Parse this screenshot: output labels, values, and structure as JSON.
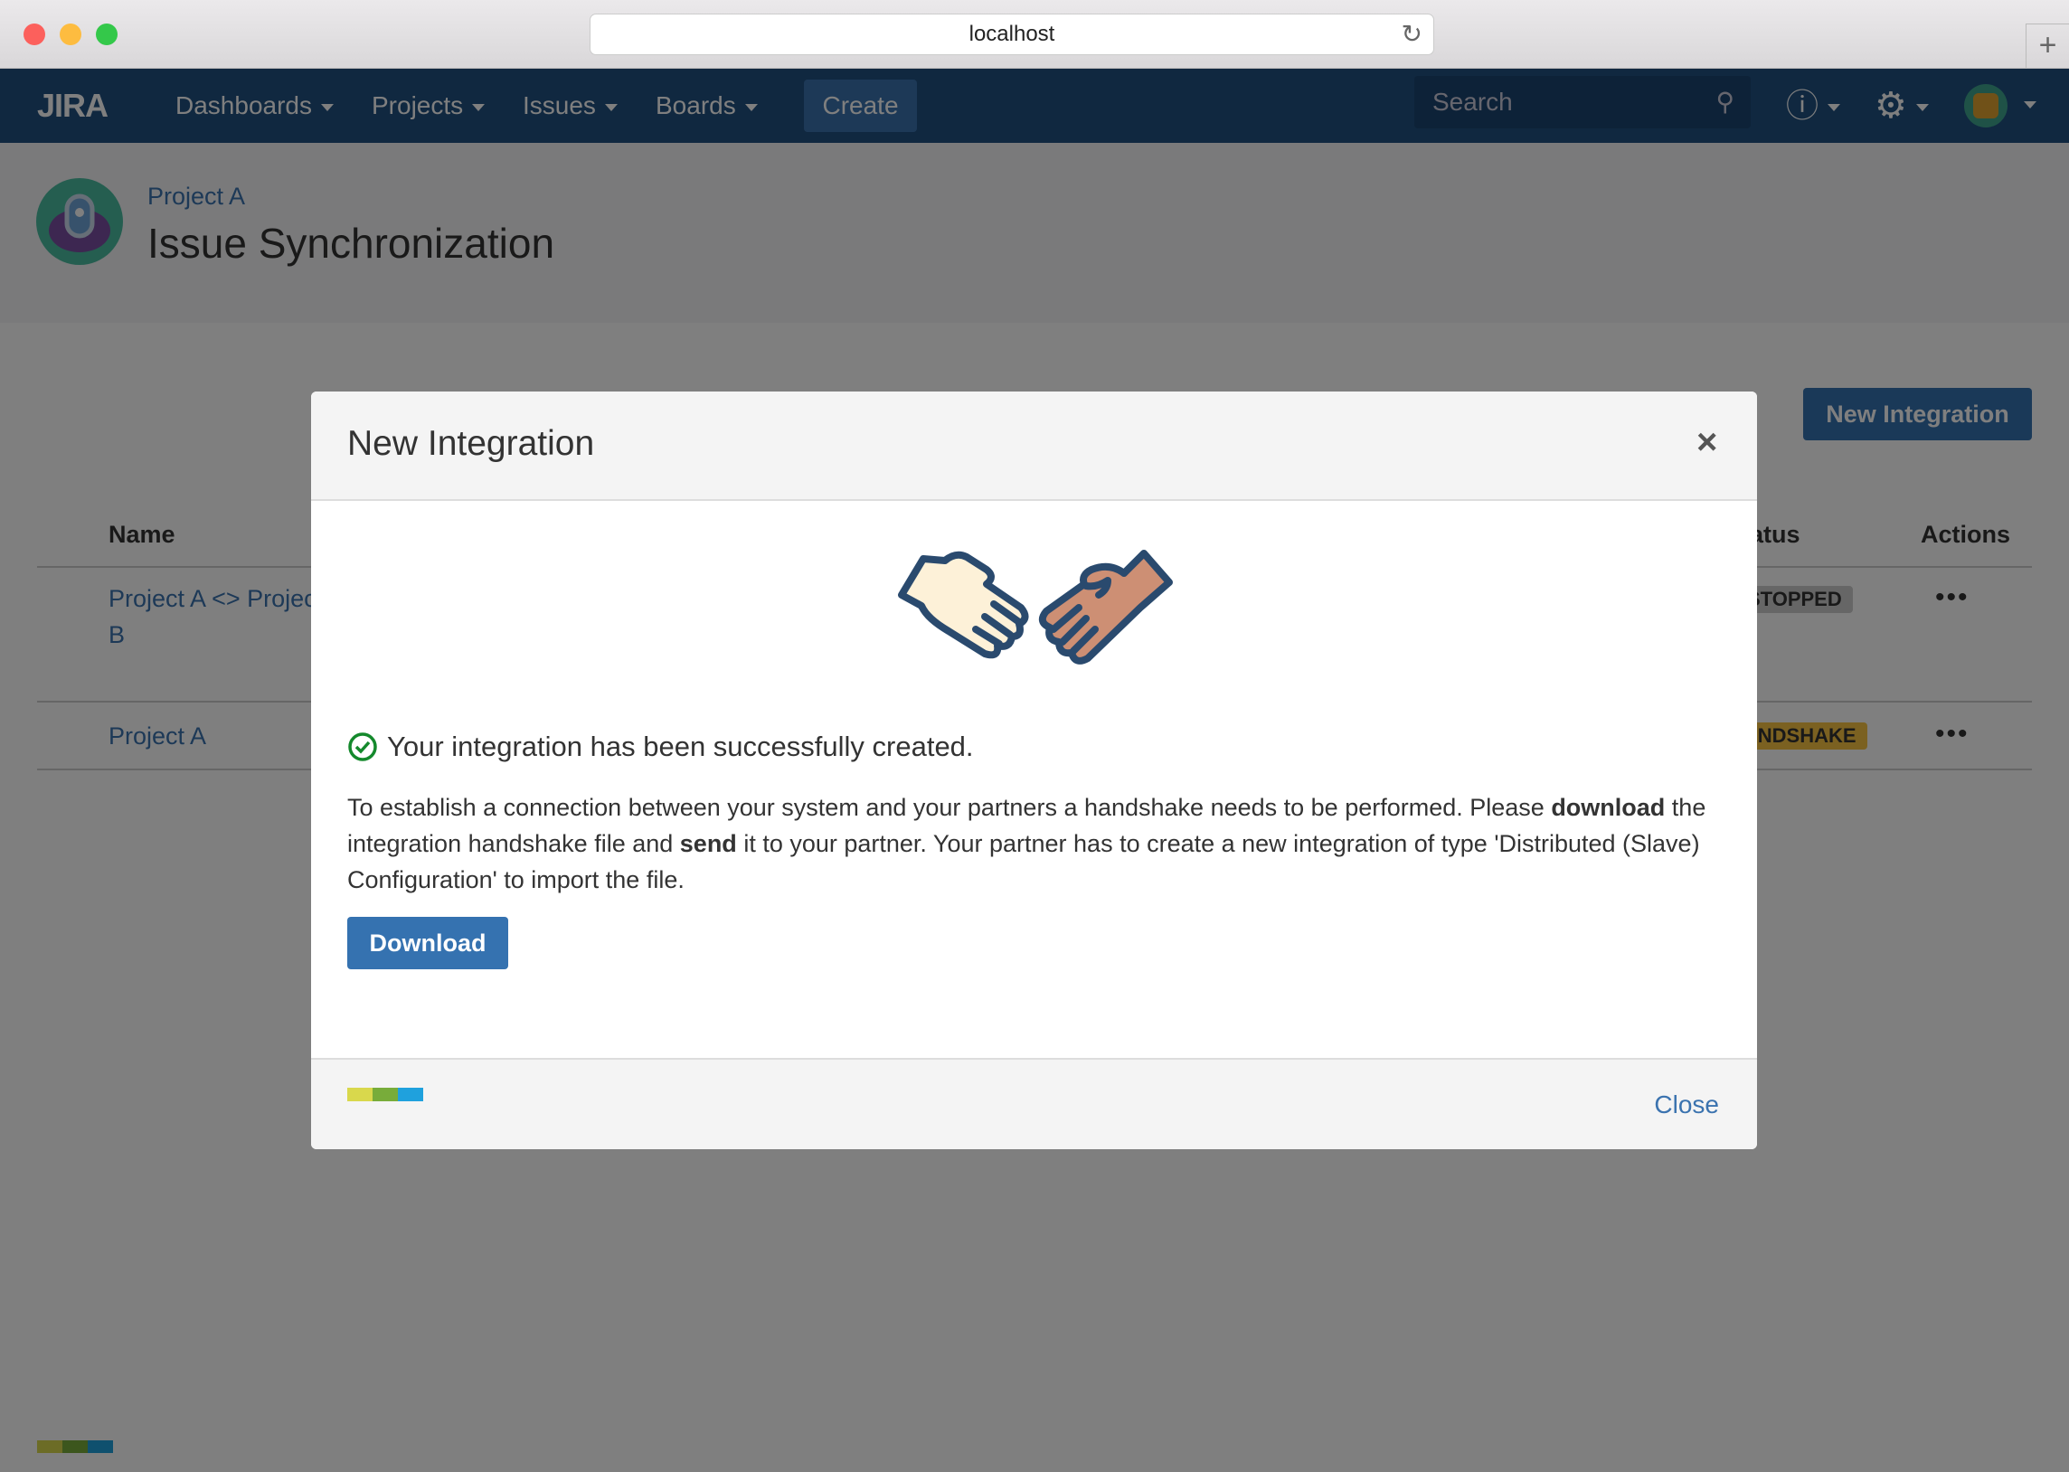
{
  "browser": {
    "url": "localhost"
  },
  "nav": {
    "logo": "JIRA",
    "items": [
      {
        "label": "Dashboards"
      },
      {
        "label": "Projects"
      },
      {
        "label": "Issues"
      },
      {
        "label": "Boards"
      }
    ],
    "create_label": "Create",
    "search_placeholder": "Search"
  },
  "header": {
    "project": "Project A",
    "title": "Issue Synchronization"
  },
  "main": {
    "new_integration_label": "New Integration",
    "columns": {
      "name": "Name",
      "status": "Status",
      "actions": "Actions"
    },
    "rows": [
      {
        "name": "Project A <> Project B",
        "status": "STOPPED",
        "actions": "•••"
      },
      {
        "name": "Project A",
        "status": "HANDSHAKE",
        "actions": "•••"
      }
    ]
  },
  "modal": {
    "title": "New Integration",
    "close_x": "×",
    "success": "Your integration has been successfully created.",
    "para": {
      "t1": "To establish a connection between your system and your partners a handshake needs to be performed. Please ",
      "b1": "download",
      "t2": " the integration handshake file and ",
      "b2": "send",
      "t3": " it to your partner. Your partner has to create a new integration of type 'Distributed (Slave) Configuration' to import the file."
    },
    "download_label": "Download",
    "close_label": "Close"
  },
  "colors": {
    "accent": "#3572b0",
    "nav": "#205081",
    "success": "#14892c",
    "stopped": "#ccc",
    "handshake": "#f6c342",
    "bar": [
      "#d9d84c",
      "#78ac3a",
      "#1fa1dd"
    ]
  }
}
